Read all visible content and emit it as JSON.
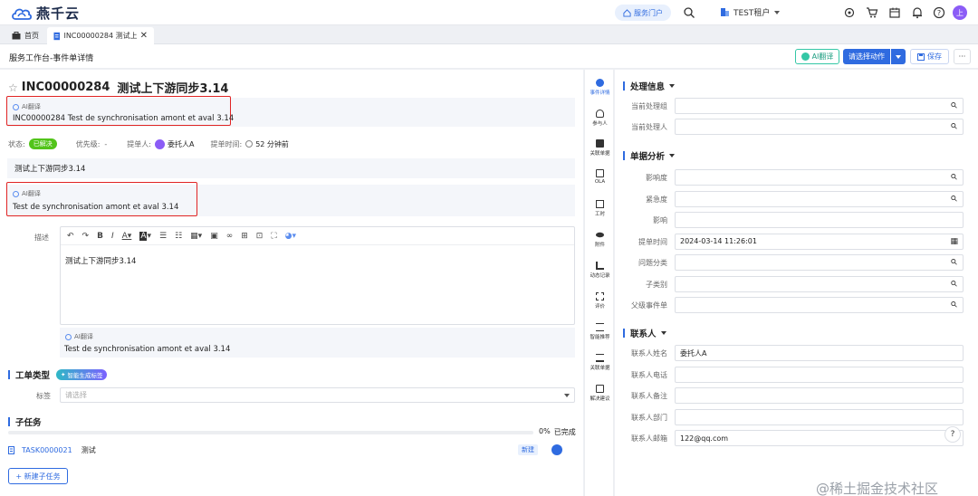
{
  "brand": {
    "name": "燕千云"
  },
  "topbar": {
    "portal_label": "服务门户",
    "tenant_label": "TEST租户",
    "avatar_text": "上"
  },
  "tabs": [
    {
      "label": "首页"
    },
    {
      "label": "INC00000284 测试上"
    }
  ],
  "header": {
    "breadcrumb": "服务工作台-事件单详情",
    "ai_translate_label": "AI翻译",
    "action_select_label": "请选择动作",
    "save_label": "保存"
  },
  "ticket": {
    "number": "INC00000284",
    "title": "测试上下游同步3.14",
    "ai_label": "AI翻译",
    "title_translation": "INC00000284 Test de synchronisation amont et aval 3.14",
    "status_label": "状态:",
    "status_value": "已解决",
    "priority_label": "优先级:",
    "priority_value": "-",
    "submitter_label": "提单人:",
    "submitter_value": "委托人A",
    "submit_time_label": "提单时间:",
    "submit_time_value": "52 分钟前",
    "summary": "测试上下游同步3.14",
    "summary_translation": "Test de synchronisation amont et aval 3.14",
    "description_label": "描述",
    "description_body": "测试上下游同步3.14",
    "description_translation": "Test de synchronisation amont et aval 3.14"
  },
  "ticket_type": {
    "title": "工单类型",
    "smart_tag_label": "智能生成标签",
    "tag_label": "标签",
    "tag_placeholder": "请选择"
  },
  "subtasks": {
    "title": "子任务",
    "progress_text": "0%",
    "progress_suffix": "已完成",
    "progress_fraction": 0,
    "items": [
      {
        "number": "TASK0000021",
        "name": "测试",
        "badge": "新建"
      }
    ],
    "add_label": "+ 新建子任务"
  },
  "rail": [
    {
      "label": "事件详情"
    },
    {
      "label": "参与人"
    },
    {
      "label": "关联单据"
    },
    {
      "label": "OLA"
    },
    {
      "label": "工时"
    },
    {
      "label": "附件"
    },
    {
      "label": "动态记录"
    },
    {
      "label": "评价"
    },
    {
      "label": "智能推荐"
    },
    {
      "label": "关联单据"
    },
    {
      "label": "解决建议"
    }
  ],
  "processing": {
    "title": "处理信息",
    "fields": [
      {
        "label": "当前处理组",
        "value": ""
      },
      {
        "label": "当前处理人",
        "value": ""
      }
    ]
  },
  "analysis": {
    "title": "单据分析",
    "fields": [
      {
        "label": "影响度",
        "value": ""
      },
      {
        "label": "紧急度",
        "value": ""
      },
      {
        "label": "影响",
        "value": ""
      },
      {
        "label": "提单时间",
        "value": "2024-03-14 11:26:01"
      },
      {
        "label": "问题分类",
        "value": ""
      },
      {
        "label": "子类别",
        "value": ""
      },
      {
        "label": "父级事件单",
        "value": ""
      }
    ]
  },
  "contact": {
    "title": "联系人",
    "fields": [
      {
        "label": "联系人姓名",
        "value": "委托人A"
      },
      {
        "label": "联系人电话",
        "value": ""
      },
      {
        "label": "联系人备注",
        "value": ""
      },
      {
        "label": "联系人部门",
        "value": ""
      },
      {
        "label": "联系人邮箱",
        "value": "122@qq.com"
      }
    ]
  },
  "watermark": "@稀土掘金技术社区",
  "colors": {
    "accent": "#2f6be0",
    "status_green": "#52c41a",
    "highlight_red": "#e02424"
  }
}
